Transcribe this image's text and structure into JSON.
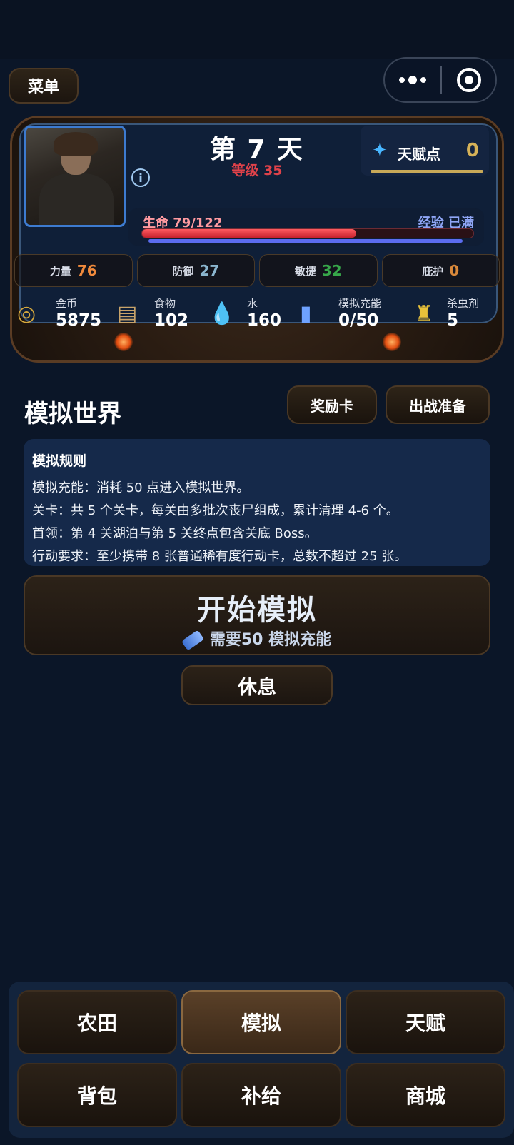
{
  "header": {
    "menu_label": "菜单"
  },
  "status": {
    "day": "第 7 天",
    "level": "等级 35",
    "talent_label": "天赋点",
    "talent_value": "0",
    "hp_label": "生命 79/122",
    "hp_fraction": 0.6475,
    "xp_label": "经验 已满"
  },
  "attributes": [
    {
      "label": "力量",
      "value": "76",
      "color": "#f08a3c"
    },
    {
      "label": "防御",
      "value": "27",
      "color": "#8bb6cf"
    },
    {
      "label": "敏捷",
      "value": "32",
      "color": "#37a84a"
    },
    {
      "label": "庇护",
      "value": "0",
      "color": "#d8883a"
    }
  ],
  "resources": [
    {
      "label": "金币",
      "value": "5875",
      "icon": "coins-icon"
    },
    {
      "label": "食物",
      "value": "102",
      "icon": "food-icon"
    },
    {
      "label": "水",
      "value": "160",
      "icon": "water-icon"
    },
    {
      "label": "模拟充能",
      "value": "0/50",
      "icon": "battery-icon"
    },
    {
      "label": "杀虫剂",
      "value": "5",
      "icon": "spray-icon"
    }
  ],
  "simulation": {
    "title": "模拟世界",
    "reward_button": "奖励卡",
    "prepare_button": "出战准备",
    "rules_title": "模拟规则",
    "rules": [
      "模拟充能：消耗 50 点进入模拟世界。",
      "关卡：共 5 个关卡，每关由多批次丧尸组成，累计清理 4-6 个。",
      "首领：第 4 关湖泊与第 5 关终点包含关底 Boss。",
      "行动要求：至少携带 8 张普通稀有度行动卡，总数不超过 25 张。"
    ],
    "start_label": "开始模拟",
    "start_sub": "需要50 模拟充能",
    "rest_label": "休息"
  },
  "nav": [
    "农田",
    "模拟",
    "天赋",
    "背包",
    "补给",
    "商城"
  ],
  "nav_active": "模拟"
}
